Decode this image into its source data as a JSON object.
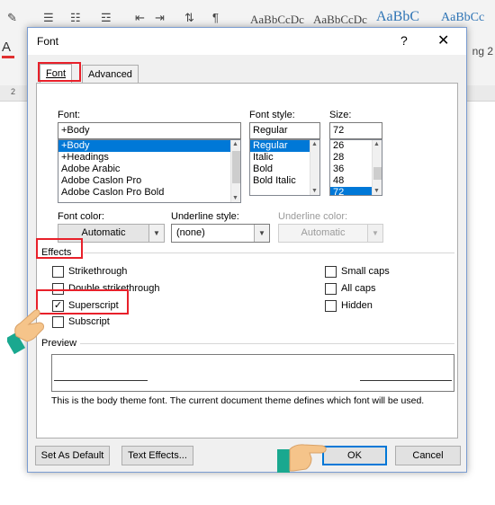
{
  "ribbon": {
    "styles": [
      "AaBbCcDc",
      "AaBbCcDc",
      "AaBbC",
      "AaBbCc"
    ],
    "font_color_letter": "A",
    "style_gallery_right": "ng 2",
    "ruler_mark": "2"
  },
  "dialog": {
    "title": "Font",
    "help": "?",
    "close": "✕",
    "tabs": [
      {
        "label": "Font",
        "active": true
      },
      {
        "label": "Advanced",
        "active": false
      }
    ],
    "font": {
      "label": "Font:",
      "value": "+Body",
      "options": [
        "+Body",
        "+Headings",
        "Adobe Arabic",
        "Adobe Caslon Pro",
        "Adobe Caslon Pro Bold"
      ],
      "selected": "+Body"
    },
    "font_style": {
      "label": "Font style:",
      "value": "Regular",
      "options": [
        "Regular",
        "Italic",
        "Bold",
        "Bold Italic"
      ],
      "selected": "Regular"
    },
    "size": {
      "label": "Size:",
      "value": "72",
      "options": [
        "26",
        "28",
        "36",
        "48",
        "72"
      ],
      "selected": "72"
    },
    "font_color": {
      "label": "Font color:",
      "value": "Automatic"
    },
    "underline_style": {
      "label": "Underline style:",
      "value": "(none)"
    },
    "underline_color": {
      "label": "Underline color:",
      "value": "Automatic"
    },
    "effects": {
      "label": "Effects",
      "left": [
        {
          "label": "Strikethrough",
          "checked": false
        },
        {
          "label": "Double strikethrough",
          "checked": false
        },
        {
          "label": "Superscript",
          "checked": true
        },
        {
          "label": "Subscript",
          "checked": false
        }
      ],
      "right": [
        {
          "label": "Small caps",
          "checked": false
        },
        {
          "label": "All caps",
          "checked": false
        },
        {
          "label": "Hidden",
          "checked": false
        }
      ]
    },
    "preview": {
      "label": "Preview",
      "note": "This is the body theme font. The current document theme defines which font will be used."
    },
    "buttons": {
      "set_default": "Set As Default",
      "text_effects": "Text Effects...",
      "ok": "OK",
      "cancel": "Cancel"
    }
  },
  "colors": {
    "highlight": "#e8202a",
    "selection": "#0078d7",
    "hand_skin": "#f5c48a",
    "hand_sleeve": "#1aa88f"
  }
}
